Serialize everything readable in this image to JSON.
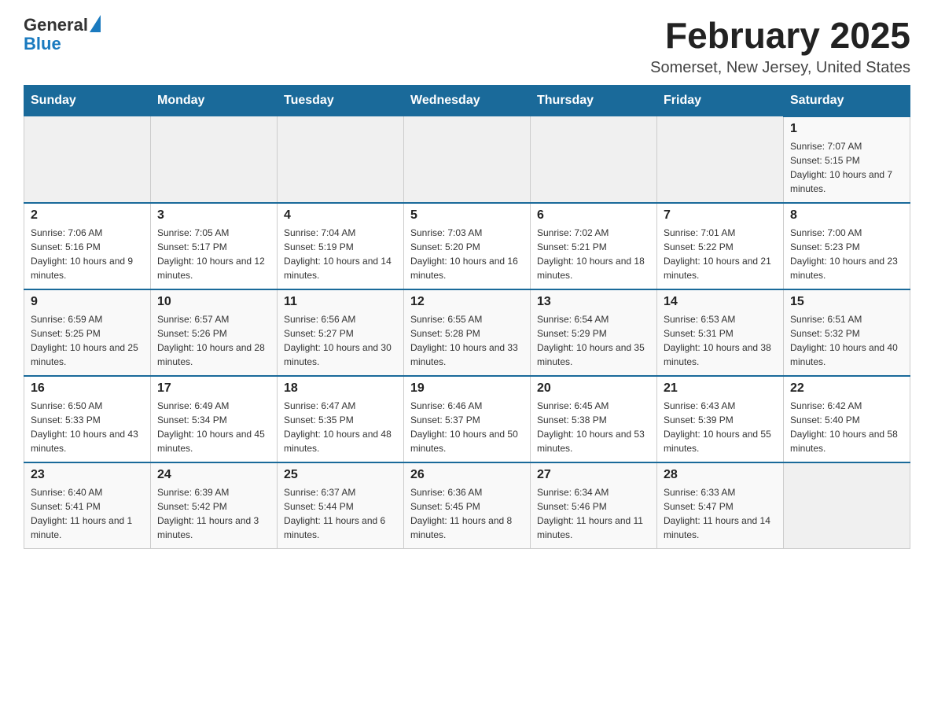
{
  "header": {
    "logo_general": "General",
    "logo_blue": "Blue",
    "title": "February 2025",
    "subtitle": "Somerset, New Jersey, United States"
  },
  "days_of_week": [
    "Sunday",
    "Monday",
    "Tuesday",
    "Wednesday",
    "Thursday",
    "Friday",
    "Saturday"
  ],
  "weeks": [
    [
      {
        "day": "",
        "info": ""
      },
      {
        "day": "",
        "info": ""
      },
      {
        "day": "",
        "info": ""
      },
      {
        "day": "",
        "info": ""
      },
      {
        "day": "",
        "info": ""
      },
      {
        "day": "",
        "info": ""
      },
      {
        "day": "1",
        "info": "Sunrise: 7:07 AM\nSunset: 5:15 PM\nDaylight: 10 hours and 7 minutes."
      }
    ],
    [
      {
        "day": "2",
        "info": "Sunrise: 7:06 AM\nSunset: 5:16 PM\nDaylight: 10 hours and 9 minutes."
      },
      {
        "day": "3",
        "info": "Sunrise: 7:05 AM\nSunset: 5:17 PM\nDaylight: 10 hours and 12 minutes."
      },
      {
        "day": "4",
        "info": "Sunrise: 7:04 AM\nSunset: 5:19 PM\nDaylight: 10 hours and 14 minutes."
      },
      {
        "day": "5",
        "info": "Sunrise: 7:03 AM\nSunset: 5:20 PM\nDaylight: 10 hours and 16 minutes."
      },
      {
        "day": "6",
        "info": "Sunrise: 7:02 AM\nSunset: 5:21 PM\nDaylight: 10 hours and 18 minutes."
      },
      {
        "day": "7",
        "info": "Sunrise: 7:01 AM\nSunset: 5:22 PM\nDaylight: 10 hours and 21 minutes."
      },
      {
        "day": "8",
        "info": "Sunrise: 7:00 AM\nSunset: 5:23 PM\nDaylight: 10 hours and 23 minutes."
      }
    ],
    [
      {
        "day": "9",
        "info": "Sunrise: 6:59 AM\nSunset: 5:25 PM\nDaylight: 10 hours and 25 minutes."
      },
      {
        "day": "10",
        "info": "Sunrise: 6:57 AM\nSunset: 5:26 PM\nDaylight: 10 hours and 28 minutes."
      },
      {
        "day": "11",
        "info": "Sunrise: 6:56 AM\nSunset: 5:27 PM\nDaylight: 10 hours and 30 minutes."
      },
      {
        "day": "12",
        "info": "Sunrise: 6:55 AM\nSunset: 5:28 PM\nDaylight: 10 hours and 33 minutes."
      },
      {
        "day": "13",
        "info": "Sunrise: 6:54 AM\nSunset: 5:29 PM\nDaylight: 10 hours and 35 minutes."
      },
      {
        "day": "14",
        "info": "Sunrise: 6:53 AM\nSunset: 5:31 PM\nDaylight: 10 hours and 38 minutes."
      },
      {
        "day": "15",
        "info": "Sunrise: 6:51 AM\nSunset: 5:32 PM\nDaylight: 10 hours and 40 minutes."
      }
    ],
    [
      {
        "day": "16",
        "info": "Sunrise: 6:50 AM\nSunset: 5:33 PM\nDaylight: 10 hours and 43 minutes."
      },
      {
        "day": "17",
        "info": "Sunrise: 6:49 AM\nSunset: 5:34 PM\nDaylight: 10 hours and 45 minutes."
      },
      {
        "day": "18",
        "info": "Sunrise: 6:47 AM\nSunset: 5:35 PM\nDaylight: 10 hours and 48 minutes."
      },
      {
        "day": "19",
        "info": "Sunrise: 6:46 AM\nSunset: 5:37 PM\nDaylight: 10 hours and 50 minutes."
      },
      {
        "day": "20",
        "info": "Sunrise: 6:45 AM\nSunset: 5:38 PM\nDaylight: 10 hours and 53 minutes."
      },
      {
        "day": "21",
        "info": "Sunrise: 6:43 AM\nSunset: 5:39 PM\nDaylight: 10 hours and 55 minutes."
      },
      {
        "day": "22",
        "info": "Sunrise: 6:42 AM\nSunset: 5:40 PM\nDaylight: 10 hours and 58 minutes."
      }
    ],
    [
      {
        "day": "23",
        "info": "Sunrise: 6:40 AM\nSunset: 5:41 PM\nDaylight: 11 hours and 1 minute."
      },
      {
        "day": "24",
        "info": "Sunrise: 6:39 AM\nSunset: 5:42 PM\nDaylight: 11 hours and 3 minutes."
      },
      {
        "day": "25",
        "info": "Sunrise: 6:37 AM\nSunset: 5:44 PM\nDaylight: 11 hours and 6 minutes."
      },
      {
        "day": "26",
        "info": "Sunrise: 6:36 AM\nSunset: 5:45 PM\nDaylight: 11 hours and 8 minutes."
      },
      {
        "day": "27",
        "info": "Sunrise: 6:34 AM\nSunset: 5:46 PM\nDaylight: 11 hours and 11 minutes."
      },
      {
        "day": "28",
        "info": "Sunrise: 6:33 AM\nSunset: 5:47 PM\nDaylight: 11 hours and 14 minutes."
      },
      {
        "day": "",
        "info": ""
      }
    ]
  ]
}
